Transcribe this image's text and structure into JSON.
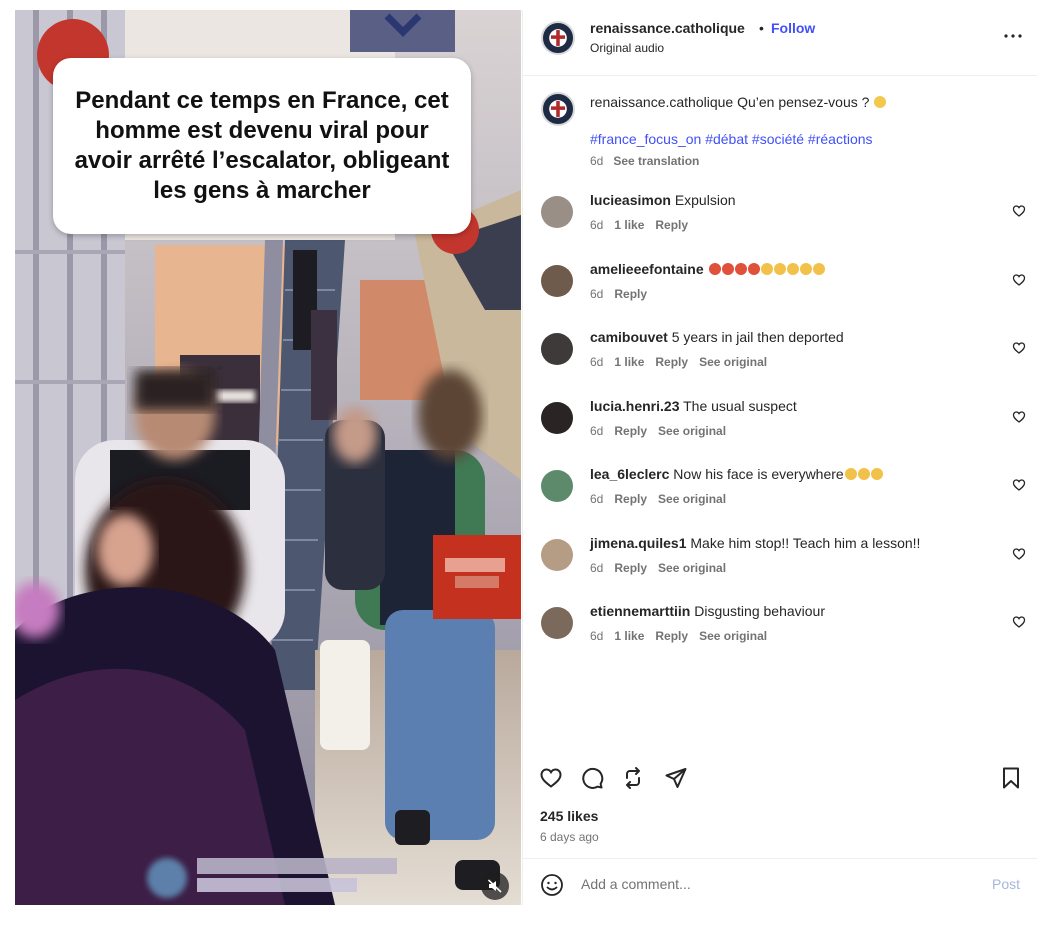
{
  "media": {
    "overlay_caption": "Pendant ce temps en France, cet homme est devenu viral pour avoir arrêté l’escalator, obligeant les gens à marcher",
    "mute_icon": "muted-speaker-icon"
  },
  "post": {
    "username": "renaissance.catholique",
    "separator": "•",
    "follow_label": "Follow",
    "audio": "Original audio",
    "more_icon": "more-dots-icon"
  },
  "caption": {
    "username": "renaissance.catholique",
    "text": " Qu’en pensez-vous ?",
    "emoji_color": "#f2c94c",
    "hashtags": "#france_focus_on #débat #société #réactions",
    "time": "6d",
    "see_translation": "See translation"
  },
  "comments": [
    {
      "username": "lucieasimon",
      "text": "Expulsion",
      "time": "6d",
      "likes": "1 like",
      "reply": "Reply",
      "see_original": "",
      "avatar_color": "#9a8f86",
      "emojis": []
    },
    {
      "username": "amelieeefontaine",
      "text": "",
      "time": "6d",
      "likes": "",
      "reply": "Reply",
      "see_original": "",
      "avatar_color": "#6f5b4c",
      "emojis": [
        "#e0503a",
        "#e0503a",
        "#e0503a",
        "#e0503a",
        "#f2c14a",
        "#f2c14a",
        "#f2c14a",
        "#f2c14a",
        "#f2c14a"
      ]
    },
    {
      "username": "camibouvet",
      "text": "5 years in jail then deported",
      "time": "6d",
      "likes": "1 like",
      "reply": "Reply",
      "see_original": "See original",
      "avatar_color": "#3f3a3a",
      "emojis": []
    },
    {
      "username": "lucia.henri.23",
      "text": "The usual suspect",
      "time": "6d",
      "likes": "",
      "reply": "Reply",
      "see_original": "See original",
      "avatar_color": "#2a2424",
      "emojis": []
    },
    {
      "username": "lea_6leclerc",
      "text": "Now his face is everywhere",
      "time": "6d",
      "likes": "",
      "reply": "Reply",
      "see_original": "See original",
      "avatar_color": "#5c8a6a",
      "emojis": [
        "#f2c14a",
        "#f2c14a",
        "#f2c14a"
      ]
    },
    {
      "username": "jimena.quiles1",
      "text": "Make him stop!! Teach him a lesson!!",
      "time": "6d",
      "likes": "",
      "reply": "Reply",
      "see_original": "See original",
      "avatar_color": "#b59c84",
      "emojis": []
    },
    {
      "username": "etiennemarttiin",
      "text": "Disgusting behaviour",
      "time": "6d",
      "likes": "1 like",
      "reply": "Reply",
      "see_original": "See original",
      "avatar_color": "#7b6a5c",
      "emojis": []
    }
  ],
  "footer": {
    "likes": "245 likes",
    "time_ago": "6 days ago",
    "comment_placeholder": "Add a comment...",
    "post_label": "Post",
    "icons": [
      "heart-icon",
      "comment-icon",
      "repost-icon",
      "share-icon",
      "bookmark-icon",
      "emoji-icon"
    ]
  },
  "colors": {
    "link_blue": "#4150f7",
    "muted_text": "#737373",
    "post_button_disabled": "#a5b7d8"
  }
}
